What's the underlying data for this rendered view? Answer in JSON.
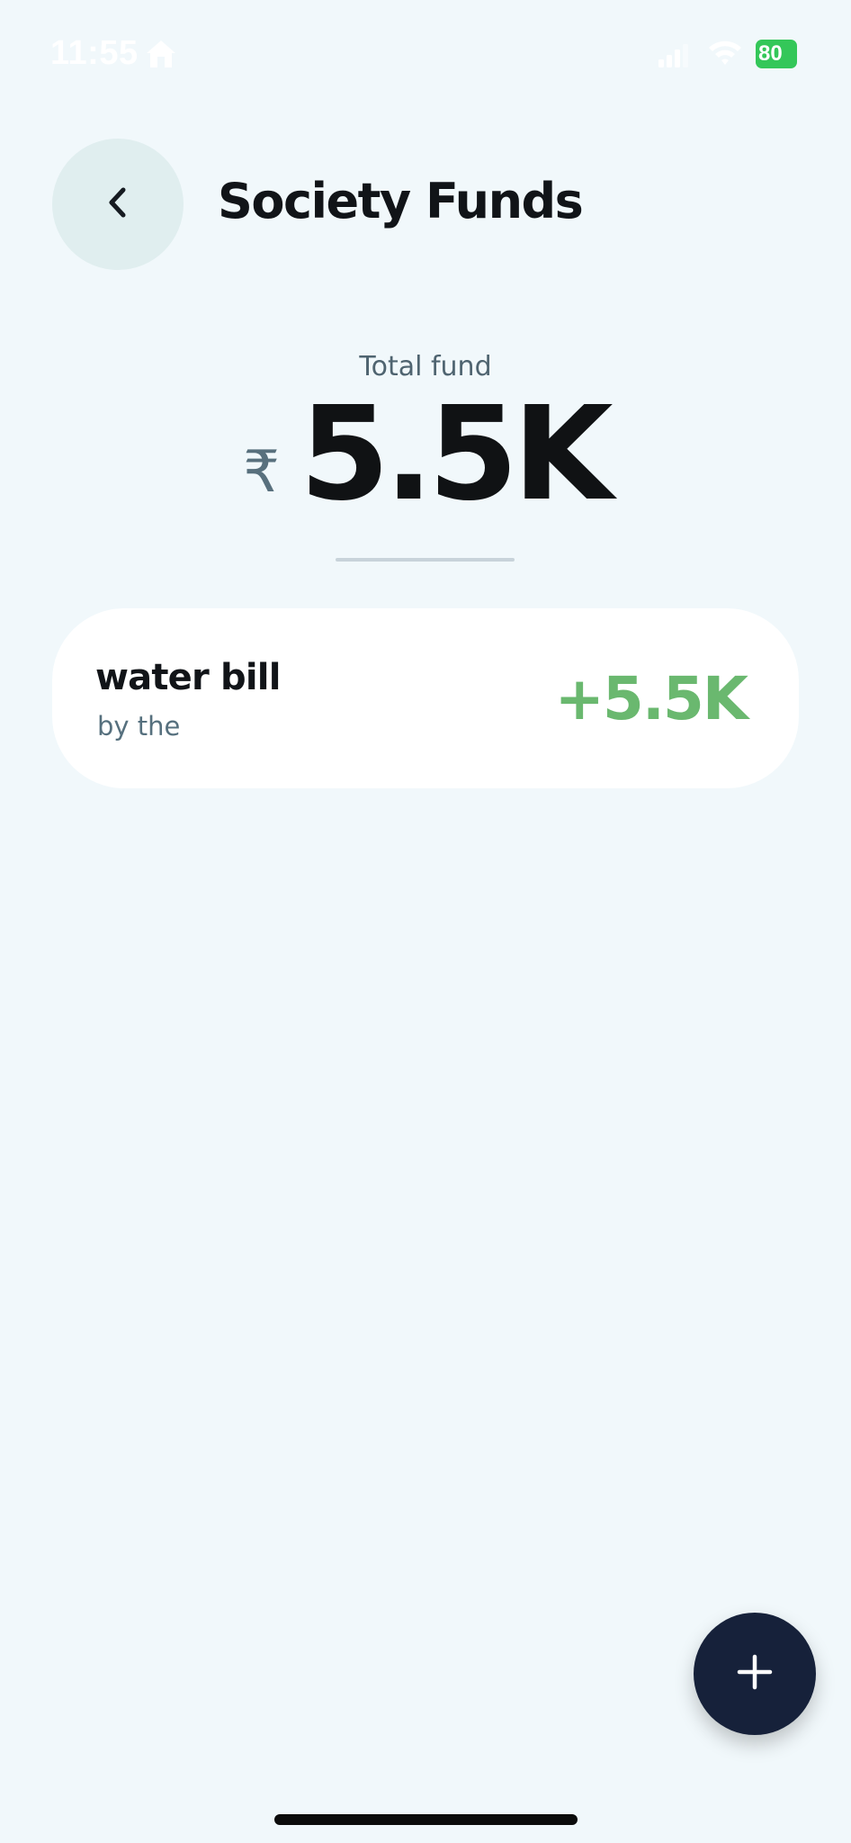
{
  "status_bar": {
    "time": "11:55",
    "battery": "80",
    "battery_color": "#34c759"
  },
  "header": {
    "title": "Society Funds",
    "back_icon": "chevron-left-icon"
  },
  "summary": {
    "label": "Total fund",
    "currency": "₹",
    "amount": "5.5K"
  },
  "funds": [
    {
      "name": "water bill",
      "subtitle": "by the",
      "amount": "+5.5K",
      "amount_color": "#6ab86f"
    }
  ],
  "fab": {
    "icon": "plus-icon",
    "color": "#16213a"
  },
  "colors": {
    "background": "#f1f8fb",
    "card": "#ffffff",
    "back_button_bg": "#e0eeef"
  }
}
